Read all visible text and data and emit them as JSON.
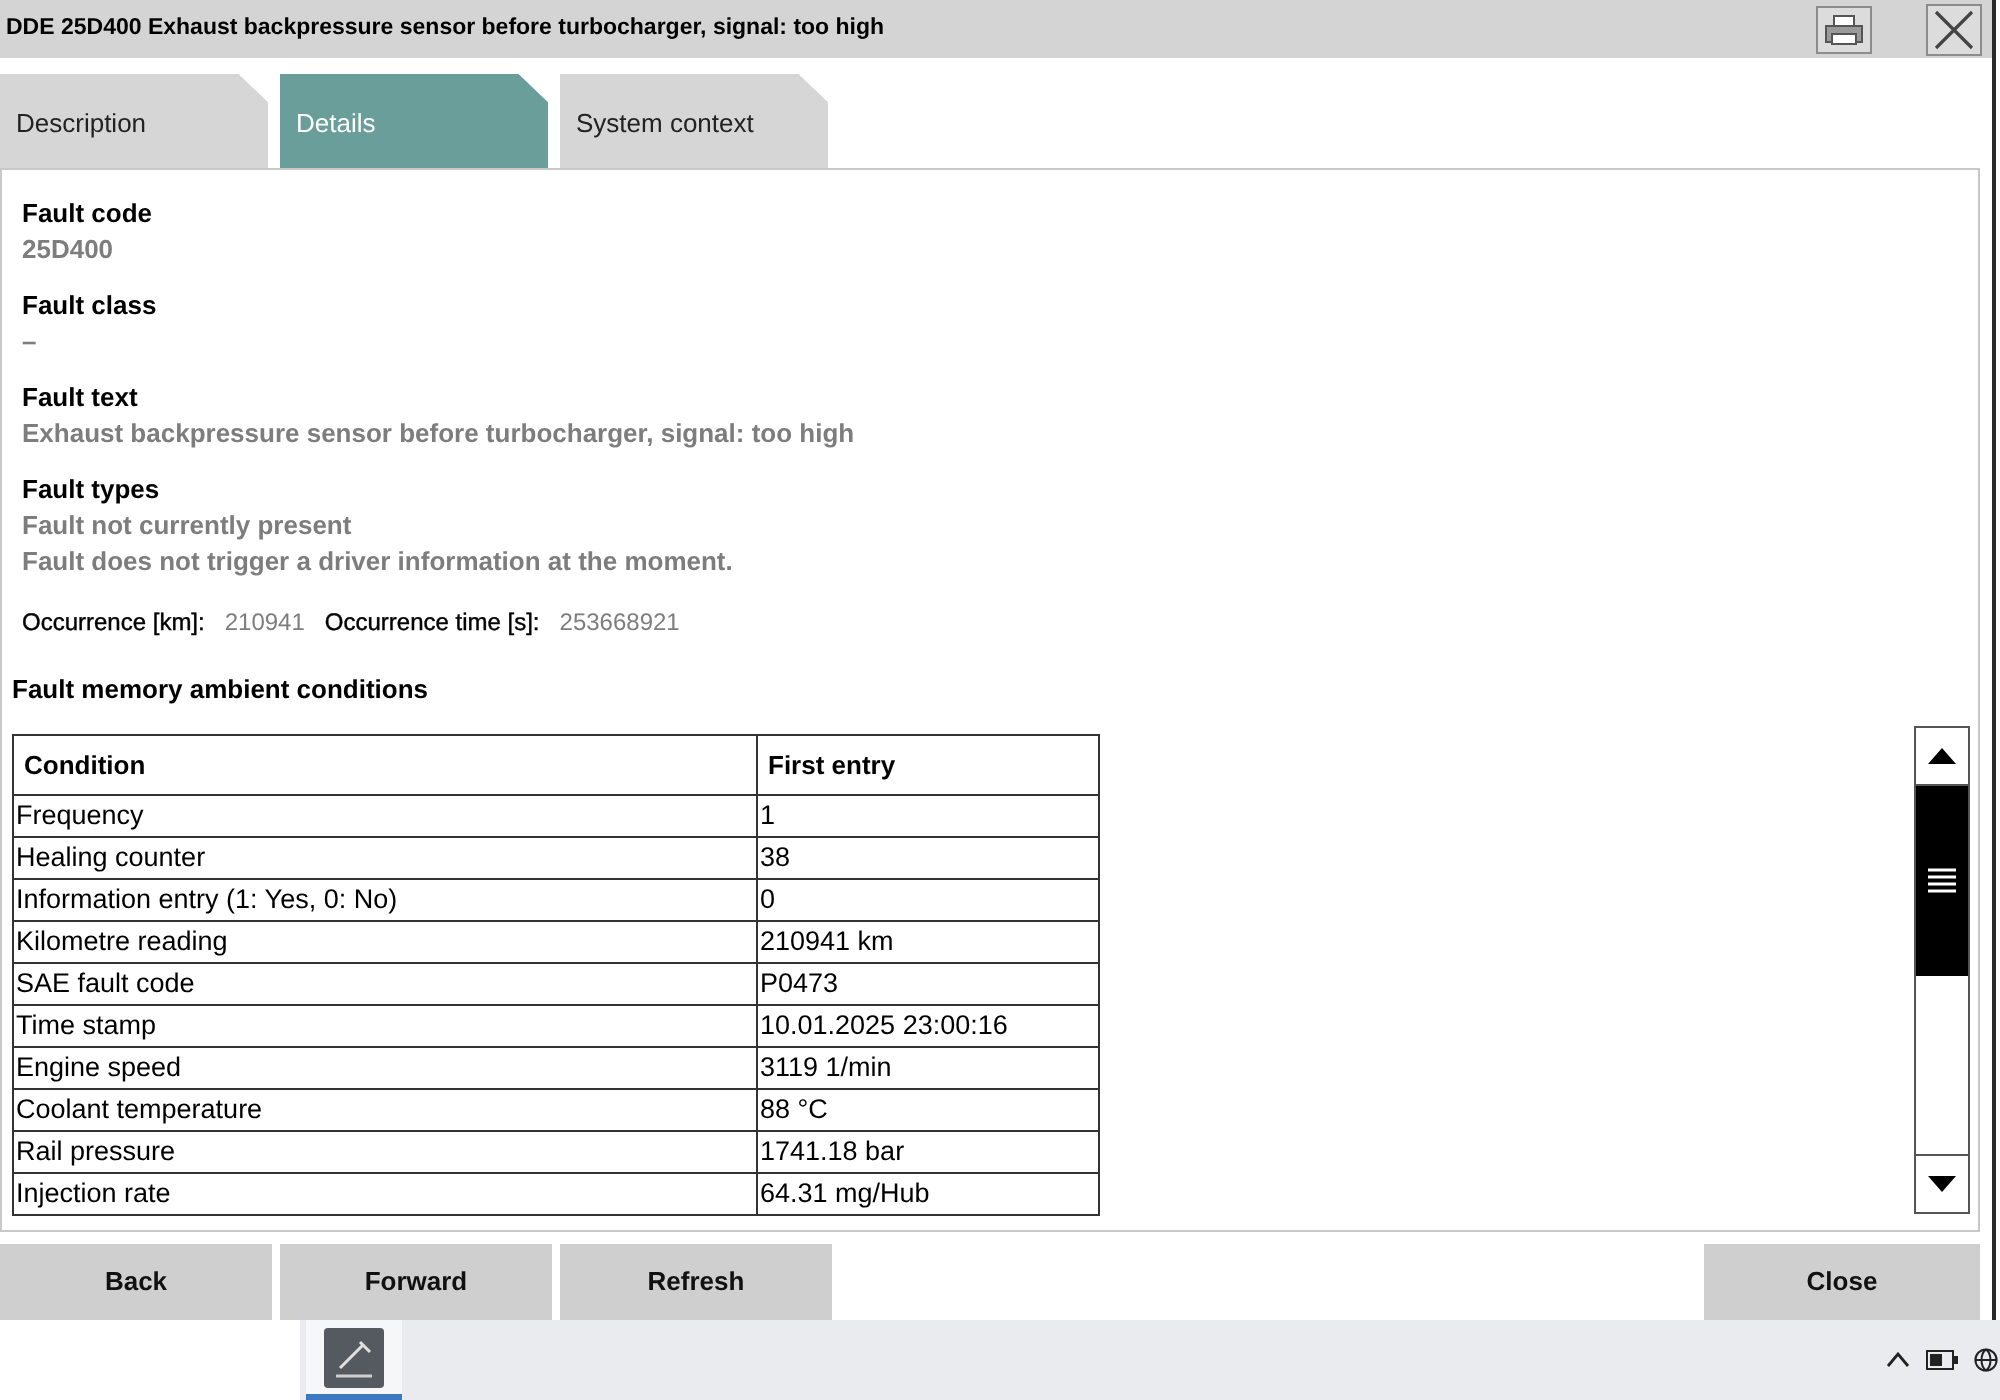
{
  "window": {
    "title": "DDE 25D400 Exhaust backpressure sensor before turbocharger, signal: too high"
  },
  "tabs": [
    {
      "label": "Description",
      "selected": false
    },
    {
      "label": "Details",
      "selected": true
    },
    {
      "label": "System context",
      "selected": false
    }
  ],
  "fields": [
    {
      "label": "Fault code",
      "values": [
        "25D400"
      ]
    },
    {
      "label": "Fault class",
      "values": [
        "–"
      ]
    },
    {
      "label": "Fault text",
      "values": [
        "Exhaust backpressure sensor before turbocharger, signal: too high"
      ]
    },
    {
      "label": "Fault types",
      "values": [
        "Fault not currently present",
        "Fault does not trigger a driver information at the moment."
      ]
    }
  ],
  "occurrence": [
    {
      "label": "Occurrence [km]:",
      "value": "210941"
    },
    {
      "label": "Occurrence time [s]:",
      "value": "253668921"
    }
  ],
  "table": {
    "title": "Fault memory ambient conditions",
    "columns": [
      "Condition",
      "First entry"
    ],
    "rows": [
      [
        "Frequency",
        "1"
      ],
      [
        "Healing counter",
        "38"
      ],
      [
        "Information entry (1: Yes, 0: No)",
        "0"
      ],
      [
        "Kilometre reading",
        "210941 km"
      ],
      [
        "SAE fault code",
        "P0473"
      ],
      [
        "Time stamp",
        "10.01.2025 23:00:16"
      ],
      [
        "Engine speed",
        "3119 1/min"
      ],
      [
        "Coolant temperature",
        "88 °C"
      ],
      [
        "Rail pressure",
        "1741.18 bar"
      ],
      [
        "Injection rate",
        "64.31 mg/Hub"
      ]
    ]
  },
  "footer": {
    "left_buttons": [
      "Back",
      "Forward",
      "Refresh"
    ],
    "right_buttons": [
      "Close"
    ]
  },
  "taskbar": {
    "apps": [
      {
        "selected": true
      }
    ]
  }
}
